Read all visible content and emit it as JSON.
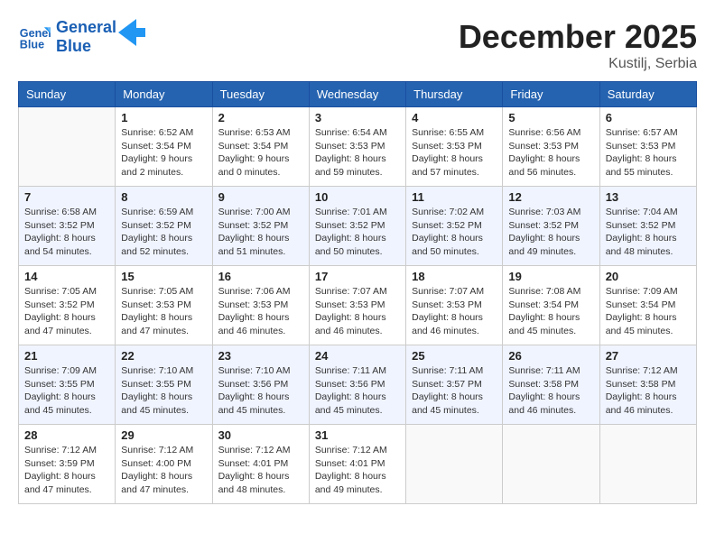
{
  "header": {
    "logo_line1": "General",
    "logo_line2": "Blue",
    "month": "December 2025",
    "location": "Kustilj, Serbia"
  },
  "weekdays": [
    "Sunday",
    "Monday",
    "Tuesday",
    "Wednesday",
    "Thursday",
    "Friday",
    "Saturday"
  ],
  "weeks": [
    [
      {
        "day": "",
        "info": ""
      },
      {
        "day": "1",
        "info": "Sunrise: 6:52 AM\nSunset: 3:54 PM\nDaylight: 9 hours\nand 2 minutes."
      },
      {
        "day": "2",
        "info": "Sunrise: 6:53 AM\nSunset: 3:54 PM\nDaylight: 9 hours\nand 0 minutes."
      },
      {
        "day": "3",
        "info": "Sunrise: 6:54 AM\nSunset: 3:53 PM\nDaylight: 8 hours\nand 59 minutes."
      },
      {
        "day": "4",
        "info": "Sunrise: 6:55 AM\nSunset: 3:53 PM\nDaylight: 8 hours\nand 57 minutes."
      },
      {
        "day": "5",
        "info": "Sunrise: 6:56 AM\nSunset: 3:53 PM\nDaylight: 8 hours\nand 56 minutes."
      },
      {
        "day": "6",
        "info": "Sunrise: 6:57 AM\nSunset: 3:53 PM\nDaylight: 8 hours\nand 55 minutes."
      }
    ],
    [
      {
        "day": "7",
        "info": "Sunrise: 6:58 AM\nSunset: 3:52 PM\nDaylight: 8 hours\nand 54 minutes."
      },
      {
        "day": "8",
        "info": "Sunrise: 6:59 AM\nSunset: 3:52 PM\nDaylight: 8 hours\nand 52 minutes."
      },
      {
        "day": "9",
        "info": "Sunrise: 7:00 AM\nSunset: 3:52 PM\nDaylight: 8 hours\nand 51 minutes."
      },
      {
        "day": "10",
        "info": "Sunrise: 7:01 AM\nSunset: 3:52 PM\nDaylight: 8 hours\nand 50 minutes."
      },
      {
        "day": "11",
        "info": "Sunrise: 7:02 AM\nSunset: 3:52 PM\nDaylight: 8 hours\nand 50 minutes."
      },
      {
        "day": "12",
        "info": "Sunrise: 7:03 AM\nSunset: 3:52 PM\nDaylight: 8 hours\nand 49 minutes."
      },
      {
        "day": "13",
        "info": "Sunrise: 7:04 AM\nSunset: 3:52 PM\nDaylight: 8 hours\nand 48 minutes."
      }
    ],
    [
      {
        "day": "14",
        "info": "Sunrise: 7:05 AM\nSunset: 3:52 PM\nDaylight: 8 hours\nand 47 minutes."
      },
      {
        "day": "15",
        "info": "Sunrise: 7:05 AM\nSunset: 3:53 PM\nDaylight: 8 hours\nand 47 minutes."
      },
      {
        "day": "16",
        "info": "Sunrise: 7:06 AM\nSunset: 3:53 PM\nDaylight: 8 hours\nand 46 minutes."
      },
      {
        "day": "17",
        "info": "Sunrise: 7:07 AM\nSunset: 3:53 PM\nDaylight: 8 hours\nand 46 minutes."
      },
      {
        "day": "18",
        "info": "Sunrise: 7:07 AM\nSunset: 3:53 PM\nDaylight: 8 hours\nand 46 minutes."
      },
      {
        "day": "19",
        "info": "Sunrise: 7:08 AM\nSunset: 3:54 PM\nDaylight: 8 hours\nand 45 minutes."
      },
      {
        "day": "20",
        "info": "Sunrise: 7:09 AM\nSunset: 3:54 PM\nDaylight: 8 hours\nand 45 minutes."
      }
    ],
    [
      {
        "day": "21",
        "info": "Sunrise: 7:09 AM\nSunset: 3:55 PM\nDaylight: 8 hours\nand 45 minutes."
      },
      {
        "day": "22",
        "info": "Sunrise: 7:10 AM\nSunset: 3:55 PM\nDaylight: 8 hours\nand 45 minutes."
      },
      {
        "day": "23",
        "info": "Sunrise: 7:10 AM\nSunset: 3:56 PM\nDaylight: 8 hours\nand 45 minutes."
      },
      {
        "day": "24",
        "info": "Sunrise: 7:11 AM\nSunset: 3:56 PM\nDaylight: 8 hours\nand 45 minutes."
      },
      {
        "day": "25",
        "info": "Sunrise: 7:11 AM\nSunset: 3:57 PM\nDaylight: 8 hours\nand 45 minutes."
      },
      {
        "day": "26",
        "info": "Sunrise: 7:11 AM\nSunset: 3:58 PM\nDaylight: 8 hours\nand 46 minutes."
      },
      {
        "day": "27",
        "info": "Sunrise: 7:12 AM\nSunset: 3:58 PM\nDaylight: 8 hours\nand 46 minutes."
      }
    ],
    [
      {
        "day": "28",
        "info": "Sunrise: 7:12 AM\nSunset: 3:59 PM\nDaylight: 8 hours\nand 47 minutes."
      },
      {
        "day": "29",
        "info": "Sunrise: 7:12 AM\nSunset: 4:00 PM\nDaylight: 8 hours\nand 47 minutes."
      },
      {
        "day": "30",
        "info": "Sunrise: 7:12 AM\nSunset: 4:01 PM\nDaylight: 8 hours\nand 48 minutes."
      },
      {
        "day": "31",
        "info": "Sunrise: 7:12 AM\nSunset: 4:01 PM\nDaylight: 8 hours\nand 49 minutes."
      },
      {
        "day": "",
        "info": ""
      },
      {
        "day": "",
        "info": ""
      },
      {
        "day": "",
        "info": ""
      }
    ]
  ]
}
